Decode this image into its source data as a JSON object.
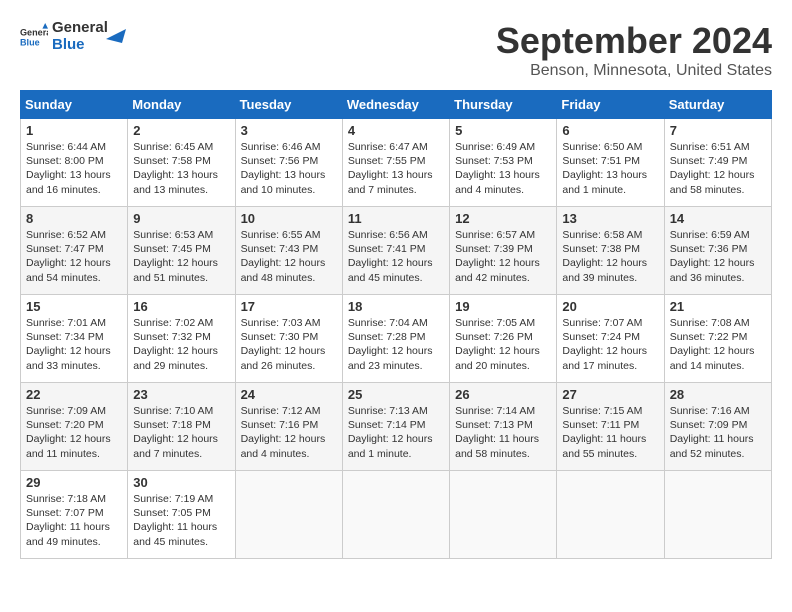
{
  "logo": {
    "text_general": "General",
    "text_blue": "Blue"
  },
  "title": "September 2024",
  "location": "Benson, Minnesota, United States",
  "weekdays": [
    "Sunday",
    "Monday",
    "Tuesday",
    "Wednesday",
    "Thursday",
    "Friday",
    "Saturday"
  ],
  "weeks": [
    [
      {
        "day": "1",
        "info": "Sunrise: 6:44 AM\nSunset: 8:00 PM\nDaylight: 13 hours\nand 16 minutes."
      },
      {
        "day": "2",
        "info": "Sunrise: 6:45 AM\nSunset: 7:58 PM\nDaylight: 13 hours\nand 13 minutes."
      },
      {
        "day": "3",
        "info": "Sunrise: 6:46 AM\nSunset: 7:56 PM\nDaylight: 13 hours\nand 10 minutes."
      },
      {
        "day": "4",
        "info": "Sunrise: 6:47 AM\nSunset: 7:55 PM\nDaylight: 13 hours\nand 7 minutes."
      },
      {
        "day": "5",
        "info": "Sunrise: 6:49 AM\nSunset: 7:53 PM\nDaylight: 13 hours\nand 4 minutes."
      },
      {
        "day": "6",
        "info": "Sunrise: 6:50 AM\nSunset: 7:51 PM\nDaylight: 13 hours\nand 1 minute."
      },
      {
        "day": "7",
        "info": "Sunrise: 6:51 AM\nSunset: 7:49 PM\nDaylight: 12 hours\nand 58 minutes."
      }
    ],
    [
      {
        "day": "8",
        "info": "Sunrise: 6:52 AM\nSunset: 7:47 PM\nDaylight: 12 hours\nand 54 minutes."
      },
      {
        "day": "9",
        "info": "Sunrise: 6:53 AM\nSunset: 7:45 PM\nDaylight: 12 hours\nand 51 minutes."
      },
      {
        "day": "10",
        "info": "Sunrise: 6:55 AM\nSunset: 7:43 PM\nDaylight: 12 hours\nand 48 minutes."
      },
      {
        "day": "11",
        "info": "Sunrise: 6:56 AM\nSunset: 7:41 PM\nDaylight: 12 hours\nand 45 minutes."
      },
      {
        "day": "12",
        "info": "Sunrise: 6:57 AM\nSunset: 7:39 PM\nDaylight: 12 hours\nand 42 minutes."
      },
      {
        "day": "13",
        "info": "Sunrise: 6:58 AM\nSunset: 7:38 PM\nDaylight: 12 hours\nand 39 minutes."
      },
      {
        "day": "14",
        "info": "Sunrise: 6:59 AM\nSunset: 7:36 PM\nDaylight: 12 hours\nand 36 minutes."
      }
    ],
    [
      {
        "day": "15",
        "info": "Sunrise: 7:01 AM\nSunset: 7:34 PM\nDaylight: 12 hours\nand 33 minutes."
      },
      {
        "day": "16",
        "info": "Sunrise: 7:02 AM\nSunset: 7:32 PM\nDaylight: 12 hours\nand 29 minutes."
      },
      {
        "day": "17",
        "info": "Sunrise: 7:03 AM\nSunset: 7:30 PM\nDaylight: 12 hours\nand 26 minutes."
      },
      {
        "day": "18",
        "info": "Sunrise: 7:04 AM\nSunset: 7:28 PM\nDaylight: 12 hours\nand 23 minutes."
      },
      {
        "day": "19",
        "info": "Sunrise: 7:05 AM\nSunset: 7:26 PM\nDaylight: 12 hours\nand 20 minutes."
      },
      {
        "day": "20",
        "info": "Sunrise: 7:07 AM\nSunset: 7:24 PM\nDaylight: 12 hours\nand 17 minutes."
      },
      {
        "day": "21",
        "info": "Sunrise: 7:08 AM\nSunset: 7:22 PM\nDaylight: 12 hours\nand 14 minutes."
      }
    ],
    [
      {
        "day": "22",
        "info": "Sunrise: 7:09 AM\nSunset: 7:20 PM\nDaylight: 12 hours\nand 11 minutes."
      },
      {
        "day": "23",
        "info": "Sunrise: 7:10 AM\nSunset: 7:18 PM\nDaylight: 12 hours\nand 7 minutes."
      },
      {
        "day": "24",
        "info": "Sunrise: 7:12 AM\nSunset: 7:16 PM\nDaylight: 12 hours\nand 4 minutes."
      },
      {
        "day": "25",
        "info": "Sunrise: 7:13 AM\nSunset: 7:14 PM\nDaylight: 12 hours\nand 1 minute."
      },
      {
        "day": "26",
        "info": "Sunrise: 7:14 AM\nSunset: 7:13 PM\nDaylight: 11 hours\nand 58 minutes."
      },
      {
        "day": "27",
        "info": "Sunrise: 7:15 AM\nSunset: 7:11 PM\nDaylight: 11 hours\nand 55 minutes."
      },
      {
        "day": "28",
        "info": "Sunrise: 7:16 AM\nSunset: 7:09 PM\nDaylight: 11 hours\nand 52 minutes."
      }
    ],
    [
      {
        "day": "29",
        "info": "Sunrise: 7:18 AM\nSunset: 7:07 PM\nDaylight: 11 hours\nand 49 minutes."
      },
      {
        "day": "30",
        "info": "Sunrise: 7:19 AM\nSunset: 7:05 PM\nDaylight: 11 hours\nand 45 minutes."
      },
      {
        "day": "",
        "info": ""
      },
      {
        "day": "",
        "info": ""
      },
      {
        "day": "",
        "info": ""
      },
      {
        "day": "",
        "info": ""
      },
      {
        "day": "",
        "info": ""
      }
    ]
  ]
}
